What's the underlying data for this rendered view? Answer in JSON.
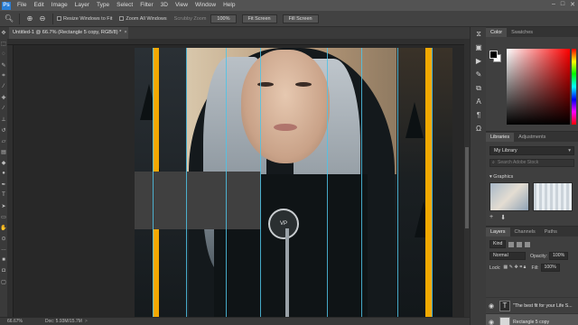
{
  "menubar": {
    "logo": "Ps",
    "items": [
      "File",
      "Edit",
      "Image",
      "Layer",
      "Type",
      "Select",
      "Filter",
      "3D",
      "View",
      "Window",
      "Help"
    ],
    "window_controls": [
      "–",
      "□",
      "✕"
    ]
  },
  "options": {
    "resize_label": "Resize Windows to Fit",
    "zoom_all_label": "Zoom All Windows",
    "scrubby_label": "Scrubby Zoom",
    "zoom_value": "100%",
    "fit_screen": "Fit Screen",
    "fill_screen": "Fill Screen"
  },
  "document": {
    "tab_title": "Untitled-1 @ 66.7% (Rectangle 5 copy, RGB/8) *",
    "close": "×"
  },
  "status": {
    "zoom": "66.67%",
    "doc": "Doc: 5.93M/15.7M",
    "arrow": ">"
  },
  "color_panel": {
    "tabs": [
      "Color",
      "Swatches"
    ],
    "foreground": "#000000",
    "background": "#ffffff"
  },
  "libraries_panel": {
    "tabs": [
      "Libraries",
      "Adjustments"
    ],
    "library": "My Library",
    "search_placeholder": "Search Adobe Stock",
    "graphics_label": "Graphics",
    "footer_icons": [
      "+",
      "⬇"
    ]
  },
  "layers_panel": {
    "tabs": [
      "Layers",
      "Channels",
      "Paths"
    ],
    "filter_kind": "Kind",
    "blend_mode": "Normal",
    "opacity_label": "Opacity:",
    "opacity_value": "100%",
    "lock_label": "Lock:",
    "fill_label": "Fill:",
    "fill_value": "100%",
    "layers": [
      {
        "name": "\"The best fit for your Life S...",
        "type": "text",
        "thumb": "T"
      },
      {
        "name": "Rectangle 5 copy",
        "type": "shape",
        "thumb": ""
      }
    ]
  },
  "photo": {
    "medal_text": "VP"
  },
  "colors": {
    "accent_gold": "#f2a900",
    "guide_cyan": "#4fc3e6"
  }
}
